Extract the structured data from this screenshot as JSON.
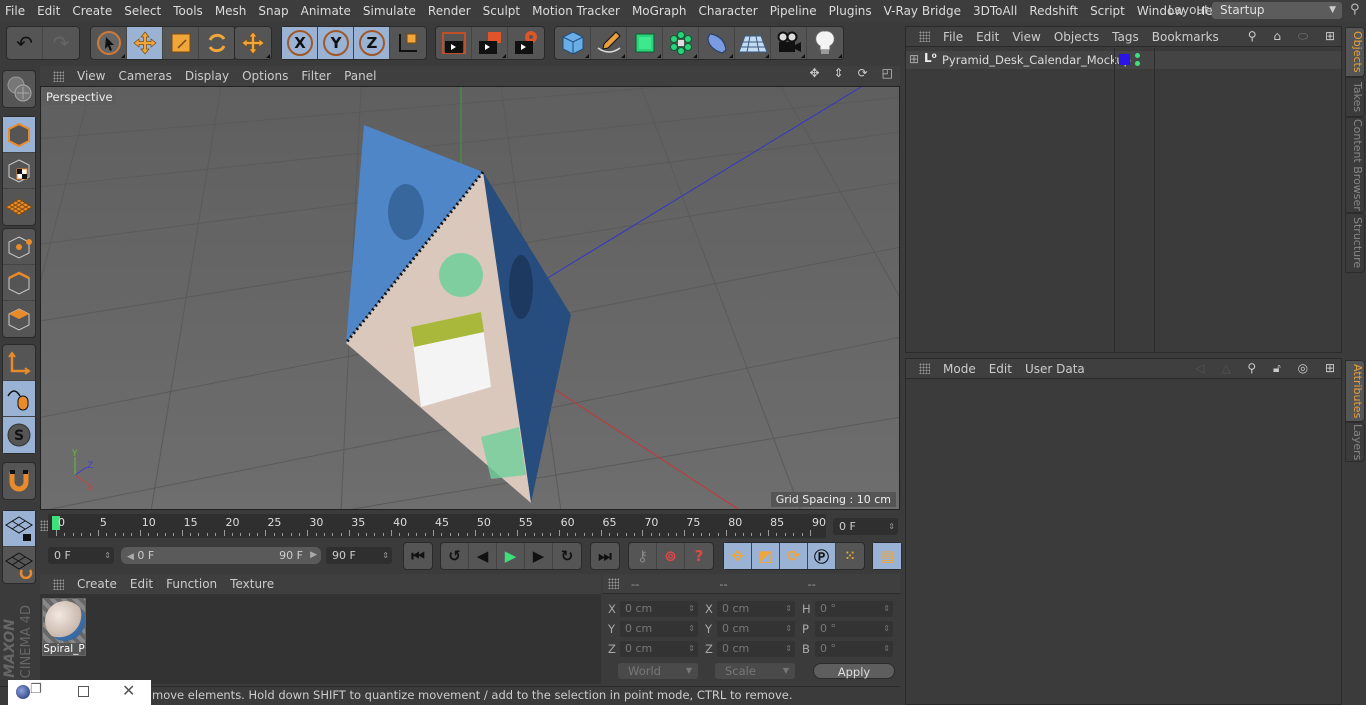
{
  "menubar": {
    "items": [
      "File",
      "Edit",
      "Create",
      "Select",
      "Tools",
      "Mesh",
      "Snap",
      "Animate",
      "Simulate",
      "Render",
      "Sculpt",
      "Motion Tracker",
      "MoGraph",
      "Character",
      "Pipeline",
      "Plugins",
      "V-Ray Bridge",
      "3DToAll",
      "Redshift",
      "Script",
      "Window",
      "Help"
    ],
    "layout_label": "Layout:",
    "layout_value": "Startup"
  },
  "toolbar": {
    "icons": [
      "undo-icon",
      "redo-icon",
      "live-selection-icon",
      "move-icon",
      "scale-icon",
      "rotate-icon",
      "recent-tools-icon",
      "x-axis-lock-icon",
      "y-axis-lock-icon",
      "z-axis-lock-icon",
      "coordinate-system-icon",
      "render-view-icon",
      "render-to-picture-viewer-icon",
      "render-settings-icon",
      "cube-icon",
      "pen-icon",
      "subdivision-icon",
      "cloner-icon",
      "deformer-icon",
      "floor-icon",
      "camera-icon",
      "light-icon"
    ]
  },
  "viewport": {
    "menu": [
      "View",
      "Cameras",
      "Display",
      "Options",
      "Filter",
      "Panel"
    ],
    "camera_label": "Perspective",
    "grid_spacing": "Grid Spacing : 10 cm",
    "axis_labels": {
      "x": "X",
      "y": "Y",
      "z": "Z"
    }
  },
  "timeline": {
    "ticks": [
      "0",
      "5",
      "10",
      "15",
      "20",
      "25",
      "30",
      "35",
      "40",
      "45",
      "50",
      "55",
      "60",
      "65",
      "70",
      "75",
      "80",
      "85",
      "90"
    ],
    "current_frame": "0 F",
    "start_field": "0 F",
    "range_start": "0 F",
    "range_end": "90 F",
    "end_field": "90 F"
  },
  "materials": {
    "menu": [
      "Create",
      "Edit",
      "Function",
      "Texture"
    ],
    "items": [
      {
        "name": "Spiral_P"
      }
    ]
  },
  "coordinates": {
    "headers": [
      "--",
      "--",
      "--"
    ],
    "rows": [
      {
        "l1": "X",
        "v1": "0 cm",
        "l2": "X",
        "v2": "0 cm",
        "l3": "H",
        "v3": "0 °"
      },
      {
        "l1": "Y",
        "v1": "0 cm",
        "l2": "Y",
        "v2": "0 cm",
        "l3": "P",
        "v3": "0 °"
      },
      {
        "l1": "Z",
        "v1": "0 cm",
        "l2": "Z",
        "v2": "0 cm",
        "l3": "B",
        "v3": "0 °"
      }
    ],
    "mode_dropdown": "World",
    "type_dropdown": "Scale",
    "apply_label": "Apply"
  },
  "objects": {
    "menu": [
      "File",
      "Edit",
      "View",
      "Objects",
      "Tags",
      "Bookmarks"
    ],
    "tree": [
      {
        "name": "Pyramid_Desk_Calendar_Mockup",
        "color": "#2a14e8"
      }
    ]
  },
  "attributes": {
    "menu": [
      "Mode",
      "Edit",
      "User Data"
    ]
  },
  "side_tabs": {
    "top": [
      "Objects",
      "Takes",
      "Content Browser",
      "Structure"
    ],
    "bottom": [
      "Attributes",
      "Layers"
    ]
  },
  "status": {
    "text": "move elements. Hold down SHIFT to quantize movement / add to the selection in point mode, CTRL to remove."
  },
  "branding": {
    "maxon": "MAXON",
    "product": "CINEMA 4D"
  }
}
